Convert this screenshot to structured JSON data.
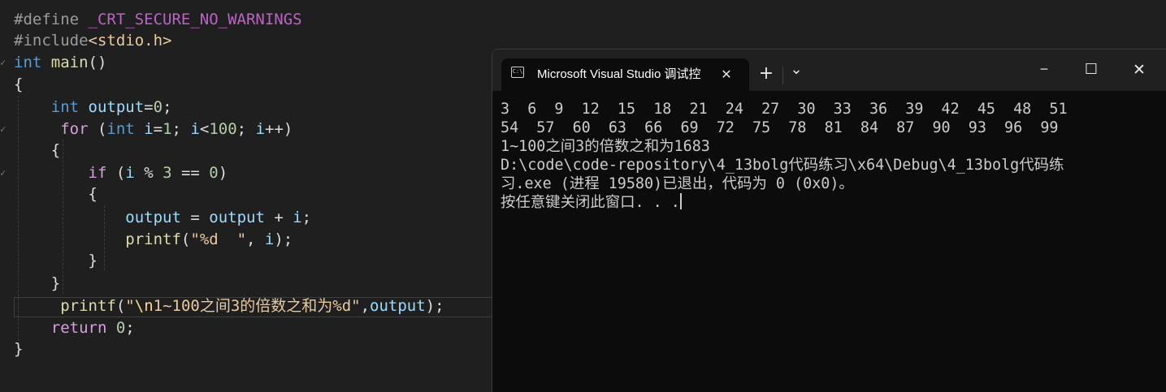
{
  "editor": {
    "lines": [
      [
        {
          "t": "#define ",
          "c": "pp"
        },
        {
          "t": "_CRT_SECURE_NO_WARNINGS",
          "c": "macro"
        }
      ],
      [
        {
          "t": "#include",
          "c": "pp"
        },
        {
          "t": "<stdio.h>",
          "c": "inc"
        }
      ],
      [
        {
          "t": "int ",
          "c": "kw"
        },
        {
          "t": "main",
          "c": "fn"
        },
        {
          "t": "()",
          "c": "plain"
        }
      ],
      [
        {
          "t": "{",
          "c": "plain"
        }
      ],
      [
        {
          "t": "    ",
          "c": "plain"
        },
        {
          "t": "int ",
          "c": "kw"
        },
        {
          "t": "output",
          "c": "var"
        },
        {
          "t": "=",
          "c": "plain"
        },
        {
          "t": "0",
          "c": "num"
        },
        {
          "t": ";",
          "c": "plain"
        }
      ],
      [
        {
          "t": "     ",
          "c": "plain"
        },
        {
          "t": "for ",
          "c": "ctl"
        },
        {
          "t": "(",
          "c": "plain"
        },
        {
          "t": "int ",
          "c": "kw"
        },
        {
          "t": "i",
          "c": "var"
        },
        {
          "t": "=",
          "c": "plain"
        },
        {
          "t": "1",
          "c": "num"
        },
        {
          "t": "; ",
          "c": "plain"
        },
        {
          "t": "i",
          "c": "var"
        },
        {
          "t": "<",
          "c": "plain"
        },
        {
          "t": "100",
          "c": "num"
        },
        {
          "t": "; ",
          "c": "plain"
        },
        {
          "t": "i",
          "c": "var"
        },
        {
          "t": "++)",
          "c": "plain"
        }
      ],
      [
        {
          "t": "    {",
          "c": "plain"
        }
      ],
      [
        {
          "t": "        ",
          "c": "plain"
        },
        {
          "t": "if ",
          "c": "ctl"
        },
        {
          "t": "(",
          "c": "plain"
        },
        {
          "t": "i",
          "c": "var"
        },
        {
          "t": " % ",
          "c": "plain"
        },
        {
          "t": "3",
          "c": "num"
        },
        {
          "t": " == ",
          "c": "plain"
        },
        {
          "t": "0",
          "c": "num"
        },
        {
          "t": ")",
          "c": "plain"
        }
      ],
      [
        {
          "t": "        {",
          "c": "plain"
        }
      ],
      [
        {
          "t": "            ",
          "c": "plain"
        },
        {
          "t": "output",
          "c": "var"
        },
        {
          "t": " = ",
          "c": "plain"
        },
        {
          "t": "output",
          "c": "var"
        },
        {
          "t": " + ",
          "c": "plain"
        },
        {
          "t": "i",
          "c": "var"
        },
        {
          "t": ";",
          "c": "plain"
        }
      ],
      [
        {
          "t": "            ",
          "c": "plain"
        },
        {
          "t": "printf",
          "c": "fn"
        },
        {
          "t": "(",
          "c": "plain"
        },
        {
          "t": "\"%d  \"",
          "c": "str"
        },
        {
          "t": ", ",
          "c": "plain"
        },
        {
          "t": "i",
          "c": "var"
        },
        {
          "t": ");",
          "c": "plain"
        }
      ],
      [
        {
          "t": "        }",
          "c": "plain"
        }
      ],
      [
        {
          "t": "    }",
          "c": "plain"
        }
      ],
      [
        {
          "t": "     ",
          "c": "plain"
        },
        {
          "t": "printf",
          "c": "fn"
        },
        {
          "t": "(",
          "c": "plain"
        },
        {
          "t": "\"",
          "c": "str"
        },
        {
          "t": "\\n",
          "c": "esc"
        },
        {
          "t": "1~100之间3的倍数之和为%d\"",
          "c": "str"
        },
        {
          "t": ",",
          "c": "plain"
        },
        {
          "t": "output",
          "c": "var"
        },
        {
          "t": ");",
          "c": "plain"
        }
      ],
      [
        {
          "t": "    ",
          "c": "plain"
        },
        {
          "t": "return ",
          "c": "ctl"
        },
        {
          "t": "0",
          "c": "num"
        },
        {
          "t": ";",
          "c": "plain"
        }
      ],
      [
        {
          "t": "}",
          "c": "plain"
        }
      ]
    ],
    "gutter_marks": [
      "",
      "",
      "✓",
      "",
      "",
      "✓",
      "",
      "✓",
      "",
      "",
      "",
      "",
      "",
      "",
      "",
      ""
    ]
  },
  "console": {
    "tab_title": "Microsoft Visual Studio 调试控",
    "tab_icon_text": "C:\\",
    "tab_close": "✕",
    "new_tab": "+",
    "dropdown": "⌄",
    "minimize": "─",
    "maximize": "☐",
    "close": "✕",
    "output_lines": [
      "3  6  9  12  15  18  21  24  27  30  33  36  39  42  45  48  51",
      "54  57  60  63  66  69  72  75  78  81  84  87  90  93  96  99",
      "1~100之间3的倍数之和为1683",
      "D:\\code\\code-repository\\4_13bolg代码练习\\x64\\Debug\\4_13bolg代码练",
      "习.exe (进程 19580)已退出，代码为 0 (0x0)。",
      "按任意键关闭此窗口. . ."
    ]
  },
  "colors": {
    "editor_bg": "#1f1f1f",
    "console_bg": "#0c0c0c",
    "titlebar_bg": "#202020",
    "keyword": "#569cd6",
    "function": "#dcdcaa",
    "variable": "#9cdcfe",
    "number": "#b5cea8",
    "string": "#e8c9a0",
    "macro": "#bd63c5"
  }
}
